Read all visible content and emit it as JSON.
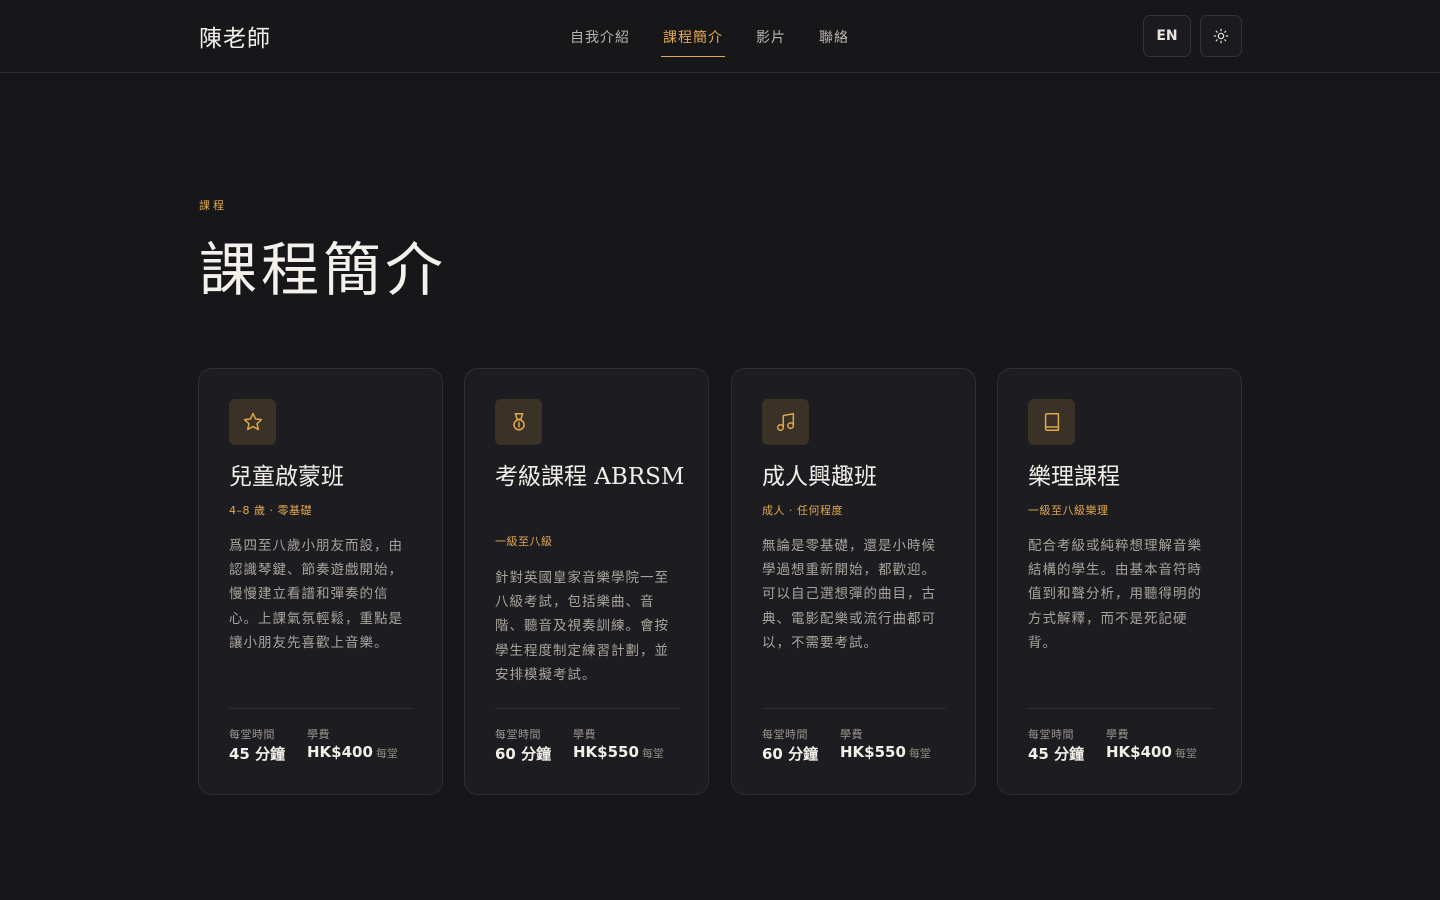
{
  "header": {
    "brand": "陳老師",
    "nav": [
      {
        "label": "自我介紹",
        "active": false
      },
      {
        "label": "課程簡介",
        "active": true
      },
      {
        "label": "影片",
        "active": false
      },
      {
        "label": "聯絡",
        "active": false
      }
    ],
    "lang_label": "EN",
    "theme_icon": "sun-icon"
  },
  "section": {
    "eyebrow": "課程",
    "title": "課程簡介"
  },
  "courses": [
    {
      "icon": "star-icon",
      "title": "兒童啟蒙班",
      "subtitle": "4–8 歲 · 零基礎",
      "description": "爲四至八歲小朋友而設，由認識琴鍵、節奏遊戲開始，慢慢建立看譜和彈奏的信心。上課氣氛輕鬆，重點是讓小朋友先喜歡上音樂。",
      "time_label": "每堂時間",
      "time_value": "45 分鐘",
      "fee_label": "學費",
      "fee_value": "HK$400",
      "fee_unit": "每堂"
    },
    {
      "icon": "medal-icon",
      "title": "考級課程 ABRSM",
      "subtitle": "一級至八級",
      "description": "針對英國皇家音樂學院一至八級考試，包括樂曲、音階、聽音及視奏訓練。會按學生程度制定練習計劃，並安排模擬考試。",
      "time_label": "每堂時間",
      "time_value": "60 分鐘",
      "fee_label": "學費",
      "fee_value": "HK$550",
      "fee_unit": "每堂"
    },
    {
      "icon": "music-note-icon",
      "title": "成人興趣班",
      "subtitle": "成人 · 任何程度",
      "description": "無論是零基礎，還是小時候學過想重新開始，都歡迎。可以自己選想彈的曲目，古典、電影配樂或流行曲都可以，不需要考試。",
      "time_label": "每堂時間",
      "time_value": "60 分鐘",
      "fee_label": "學費",
      "fee_value": "HK$550",
      "fee_unit": "每堂"
    },
    {
      "icon": "book-icon",
      "title": "樂理課程",
      "subtitle": "一級至八級樂理",
      "description": "配合考級或純粹想理解音樂結構的學生。由基本音符時值到和聲分析，用聽得明的方式解釋，而不是死記硬背。",
      "time_label": "每堂時間",
      "time_value": "45 分鐘",
      "fee_label": "學費",
      "fee_value": "HK$400",
      "fee_unit": "每堂"
    }
  ],
  "colors": {
    "background": "#171619",
    "card": "#1d1c20",
    "accent": "#e0a84f",
    "icon_tile": "#3a3227"
  }
}
